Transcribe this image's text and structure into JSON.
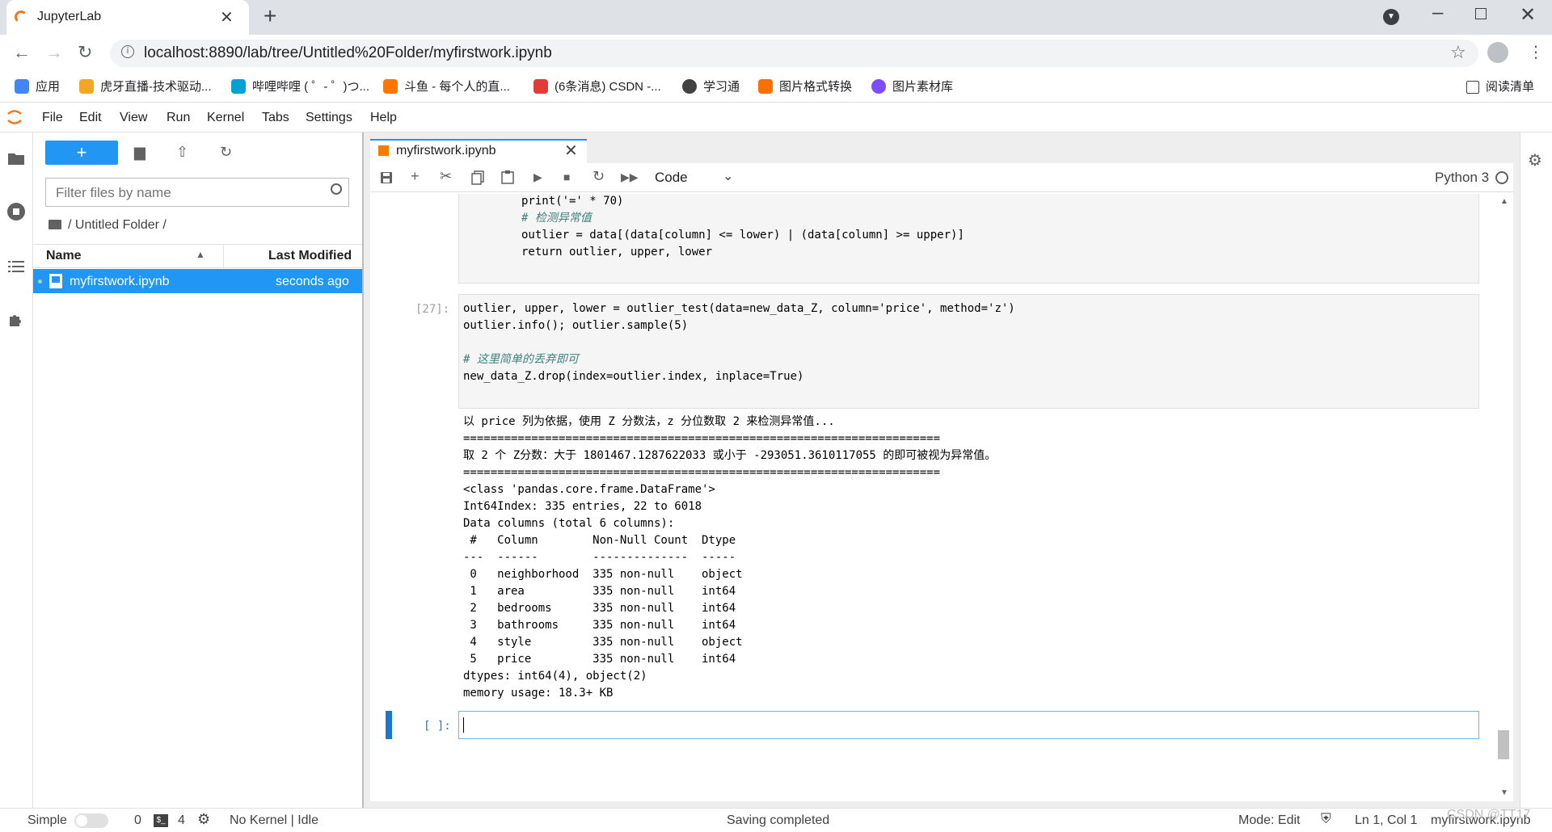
{
  "browser": {
    "tab_title": "JupyterLab",
    "url": "localhost:8890/lab/tree/Untitled%20Folder/myfirstwork.ipynb",
    "bookmarks": [
      {
        "label": "应用",
        "color": "#4285f4"
      },
      {
        "label": "虎牙直播-技术驱动...",
        "color": "#f5a623"
      },
      {
        "label": "哔哩哔哩 ( ゜- ゜)つ...",
        "color": "#00a1d6"
      },
      {
        "label": "斗鱼 - 每个人的直...",
        "color": "#ff7700"
      },
      {
        "label": "(6条消息) CSDN -...",
        "color": "#e53935"
      },
      {
        "label": "学习通",
        "color": "#424242"
      },
      {
        "label": "图片格式转换",
        "color": "#ff6f00"
      },
      {
        "label": "图片素材库",
        "color": "#7c4dff"
      }
    ],
    "reading_list": "阅读清单"
  },
  "menubar": {
    "items": [
      "File",
      "Edit",
      "View",
      "Run",
      "Kernel",
      "Tabs",
      "Settings",
      "Help"
    ]
  },
  "filebrowser": {
    "new_label": "+",
    "filter_placeholder": "Filter files by name",
    "breadcrumb": "/ Untitled Folder /",
    "col_name": "Name",
    "col_modified": "Last Modified",
    "files": [
      {
        "name": "myfirstwork.ipynb",
        "modified": "seconds ago"
      }
    ]
  },
  "notebook": {
    "tab_title": "myfirstwork.ipynb",
    "cell_type": "Code",
    "kernel": "Python 3",
    "cell1_lines": [
      "print('=' * 70)",
      "# 检测异常值",
      "outlier = data[(data[column] <= lower) | (data[column] >= upper)]",
      "return outlier, upper, lower"
    ],
    "cell2_prompt": "[27]:",
    "cell2_lines": [
      "outlier, upper, lower = outlier_test(data=new_data_Z, column='price', method='z')",
      "outlier.info(); outlier.sample(5)",
      "",
      "# 这里简单的丢弃即可",
      "new_data_Z.drop(index=outlier.index, inplace=True)"
    ],
    "output_lines": [
      "以 price 列为依据，使用 Z 分数法，z 分位数取 2 来检测异常值...",
      "======================================================================",
      "取 2 个 Z分数：大于 1801467.1287622033 或小于 -293051.3610117055 的即可被视为异常值。",
      "======================================================================",
      "<class 'pandas.core.frame.DataFrame'>",
      "Int64Index: 335 entries, 22 to 6018",
      "Data columns (total 6 columns):",
      " #   Column        Non-Null Count  Dtype ",
      "---  ------        --------------  ----- ",
      " 0   neighborhood  335 non-null    object",
      " 1   area          335 non-null    int64 ",
      " 2   bedrooms      335 non-null    int64 ",
      " 3   bathrooms     335 non-null    int64 ",
      " 4   style         335 non-null    object",
      " 5   price         335 non-null    int64 ",
      "dtypes: int64(4), object(2)",
      "memory usage: 18.3+ KB"
    ],
    "cell3_prompt": "[ ]:"
  },
  "statusbar": {
    "mode_label": "Simple",
    "count_a": "0",
    "count_b": "4",
    "kernel_status": "No Kernel | Idle",
    "message": "Saving completed",
    "mode": "Mode: Edit",
    "position": "Ln 1, Col 1",
    "filename": "myfirstwork.ipynb",
    "watermark": "CSDN @TT17"
  }
}
